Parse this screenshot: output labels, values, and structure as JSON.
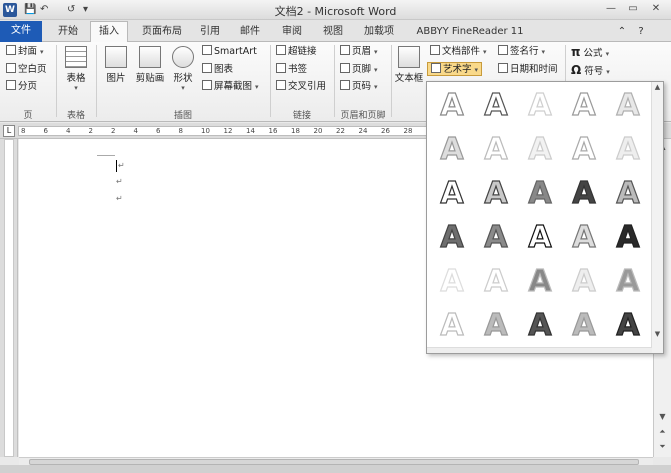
{
  "window": {
    "title": "文档2 - Microsoft Word",
    "app_icon": "W",
    "qa_save_icon": "💾",
    "qa_undo_icon": "↶",
    "qa_redo_icon": "↺",
    "qa_more_icon": "▾"
  },
  "tabs": [
    {
      "label": "文件"
    },
    {
      "label": "开始"
    },
    {
      "label": "插入"
    },
    {
      "label": "页面布局"
    },
    {
      "label": "引用"
    },
    {
      "label": "邮件"
    },
    {
      "label": "审阅"
    },
    {
      "label": "视图"
    },
    {
      "label": "加载项"
    },
    {
      "label": "ABBYY FineReader 11"
    }
  ],
  "ribbon": {
    "pages": {
      "cover": "封面",
      "blank": "空白页",
      "break": "分页",
      "label": "页"
    },
    "table": {
      "btn": "表格",
      "label": "表格"
    },
    "illustrations": {
      "picture": "图片",
      "clipart": "剪贴画",
      "shapes": "形状",
      "smartart": "SmartArt",
      "chart": "图表",
      "screenshot": "屏幕截图",
      "label": "插图"
    },
    "links": {
      "hyperlink": "超链接",
      "bookmark": "书签",
      "crossref": "交叉引用",
      "label": "链接"
    },
    "header_footer": {
      "header": "页眉",
      "footer": "页脚",
      "page_number": "页码",
      "label": "页眉和页脚"
    },
    "text": {
      "textbox": "文本框",
      "quickparts": "文档部件",
      "wordart": "艺术字",
      "signature": "签名行",
      "datetime": "日期和时间"
    },
    "symbols": {
      "equation": "公式",
      "symbol": "符号",
      "equation_icon": "π",
      "symbol_icon": "Ω"
    }
  },
  "ruler": {
    "ticks": [
      "8",
      "6",
      "4",
      "2",
      "2",
      "4",
      "6",
      "8",
      "10",
      "12",
      "14",
      "16",
      "18",
      "20",
      "22",
      "24",
      "26",
      "28"
    ]
  },
  "document": {
    "para_mark": "↵"
  },
  "wordart": {
    "glyph": "A",
    "rows": [
      [
        {
          "fill": "#ffffff",
          "stroke": "#8a8a8a"
        },
        {
          "fill": "#ffffff",
          "stroke": "#555555"
        },
        {
          "fill": "#ffffff",
          "stroke": "#cfcfcf"
        },
        {
          "fill": "#ffffff",
          "stroke": "#9a9a9a"
        },
        {
          "fill": "#e8e8e8",
          "stroke": "#b0b0b0"
        }
      ],
      [
        {
          "fill": "#dddddd",
          "stroke": "#999999"
        },
        {
          "fill": "#ffffff",
          "stroke": "#bbbbbb"
        },
        {
          "fill": "#f2f2f2",
          "stroke": "#cccccc"
        },
        {
          "fill": "#ffffff",
          "stroke": "#aaaaaa"
        },
        {
          "fill": "#eeeeee",
          "stroke": "#cccccc"
        }
      ],
      [
        {
          "fill": "#ffffff",
          "stroke": "#333333"
        },
        {
          "fill": "#c8c8c8",
          "stroke": "#444444"
        },
        {
          "fill": "#888888",
          "stroke": "#666666"
        },
        {
          "fill": "#444444",
          "stroke": "#333333"
        },
        {
          "fill": "#bbbbbb",
          "stroke": "#555555"
        }
      ],
      [
        {
          "fill": "#6e6e6e",
          "stroke": "#444444"
        },
        {
          "fill": "#8a8a8a",
          "stroke": "#555555"
        },
        {
          "fill": "#ffffff",
          "stroke": "#111111"
        },
        {
          "fill": "#dddddd",
          "stroke": "#777777"
        },
        {
          "fill": "#2a2a2a",
          "stroke": "#222222"
        }
      ],
      [
        {
          "fill": "#ffffff",
          "stroke": "#dddddd"
        },
        {
          "fill": "#ffffff",
          "stroke": "#cccccc"
        },
        {
          "fill": "#888888",
          "stroke": "#bbbbbb"
        },
        {
          "fill": "#eeeeee",
          "stroke": "#cccccc"
        },
        {
          "fill": "#9a9a9a",
          "stroke": "#bbbbbb"
        }
      ],
      [
        {
          "fill": "#ffffff",
          "stroke": "#bbbbbb"
        },
        {
          "fill": "#bbbbbb",
          "stroke": "#999999"
        },
        {
          "fill": "#555555",
          "stroke": "#333333"
        },
        {
          "fill": "#bbbbbb",
          "stroke": "#999999"
        },
        {
          "fill": "#444444",
          "stroke": "#222222"
        }
      ]
    ]
  }
}
